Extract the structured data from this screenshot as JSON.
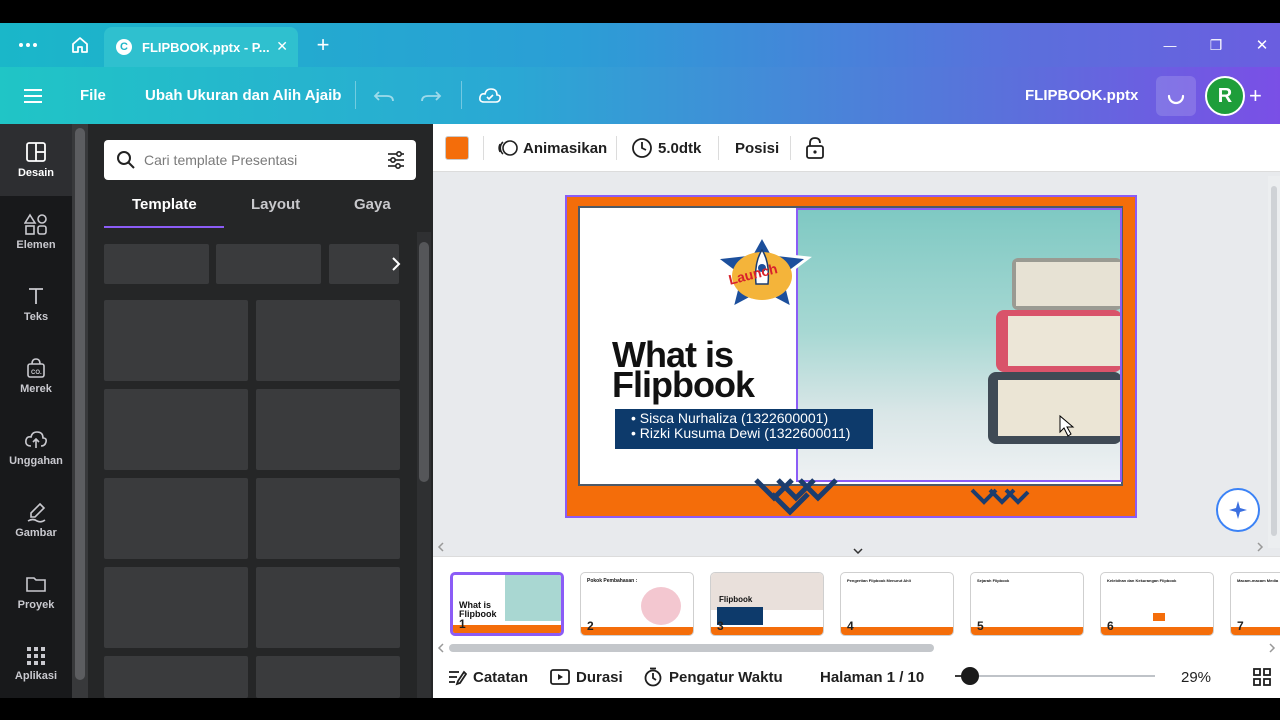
{
  "browser": {
    "tab_title": "FLIPBOOK.pptx - P...",
    "favicon_letter": "C",
    "close_glyph": "✕",
    "new_tab_glyph": "+",
    "window_controls": [
      "—",
      "❐",
      "✕"
    ]
  },
  "toolbar": {
    "file_label": "File",
    "resize_label": "Ubah Ukuran dan Alih Ajaib",
    "doc_title": "FLIPBOOK.pptx",
    "avatar_letter": "R",
    "plus_label": "+"
  },
  "rail": {
    "items": [
      {
        "label": "Desain",
        "icon": "layout-icon"
      },
      {
        "label": "Elemen",
        "icon": "shapes-icon"
      },
      {
        "label": "Teks",
        "icon": "text-icon"
      },
      {
        "label": "Merek",
        "icon": "brand-icon"
      },
      {
        "label": "Unggahan",
        "icon": "upload-icon"
      },
      {
        "label": "Gambar",
        "icon": "draw-icon"
      },
      {
        "label": "Proyek",
        "icon": "folder-icon"
      },
      {
        "label": "Aplikasi",
        "icon": "apps-icon"
      }
    ]
  },
  "panel": {
    "search_placeholder": "Cari template Presentasi",
    "tabs": [
      "Template",
      "Layout",
      "Gaya"
    ],
    "active_tab": "Template"
  },
  "context_bar": {
    "color_swatch": "#f46d0a",
    "animate_label": "Animasikan",
    "duration_label": "5.0dtk",
    "position_label": "Posisi"
  },
  "slide": {
    "title_line1": "What is",
    "title_line2": "Flipbook",
    "badge_text": "Launch",
    "names": [
      "• Sisca Nurhaliza (1322600001)",
      "• Rizki Kusuma Dewi (1322600011)"
    ]
  },
  "thumbnails": [
    {
      "num": "1",
      "title": "What is Flipbook"
    },
    {
      "num": "2",
      "title": "Pokok Pembahasan :"
    },
    {
      "num": "3",
      "title": "Flipbook"
    },
    {
      "num": "4",
      "title": "Pengertian Flipbook Menurut Ahli"
    },
    {
      "num": "5",
      "title": "Sejarah Flipbook"
    },
    {
      "num": "6",
      "title": "Kelebihan dan Kekurangan Flipbook"
    },
    {
      "num": "7",
      "title": "Macam-macam Media"
    }
  ],
  "bottom": {
    "notes_label": "Catatan",
    "duration_label": "Durasi",
    "timer_label": "Pengatur Waktu",
    "page_label": "Halaman 1 / 10",
    "zoom_label": "29%",
    "zoom_value": 0.29
  },
  "colors": {
    "accent": "#8b5cf6",
    "slide_orange": "#f46d0a",
    "name_box": "#0d3a6b",
    "avatar_green": "#1e9e3a"
  }
}
